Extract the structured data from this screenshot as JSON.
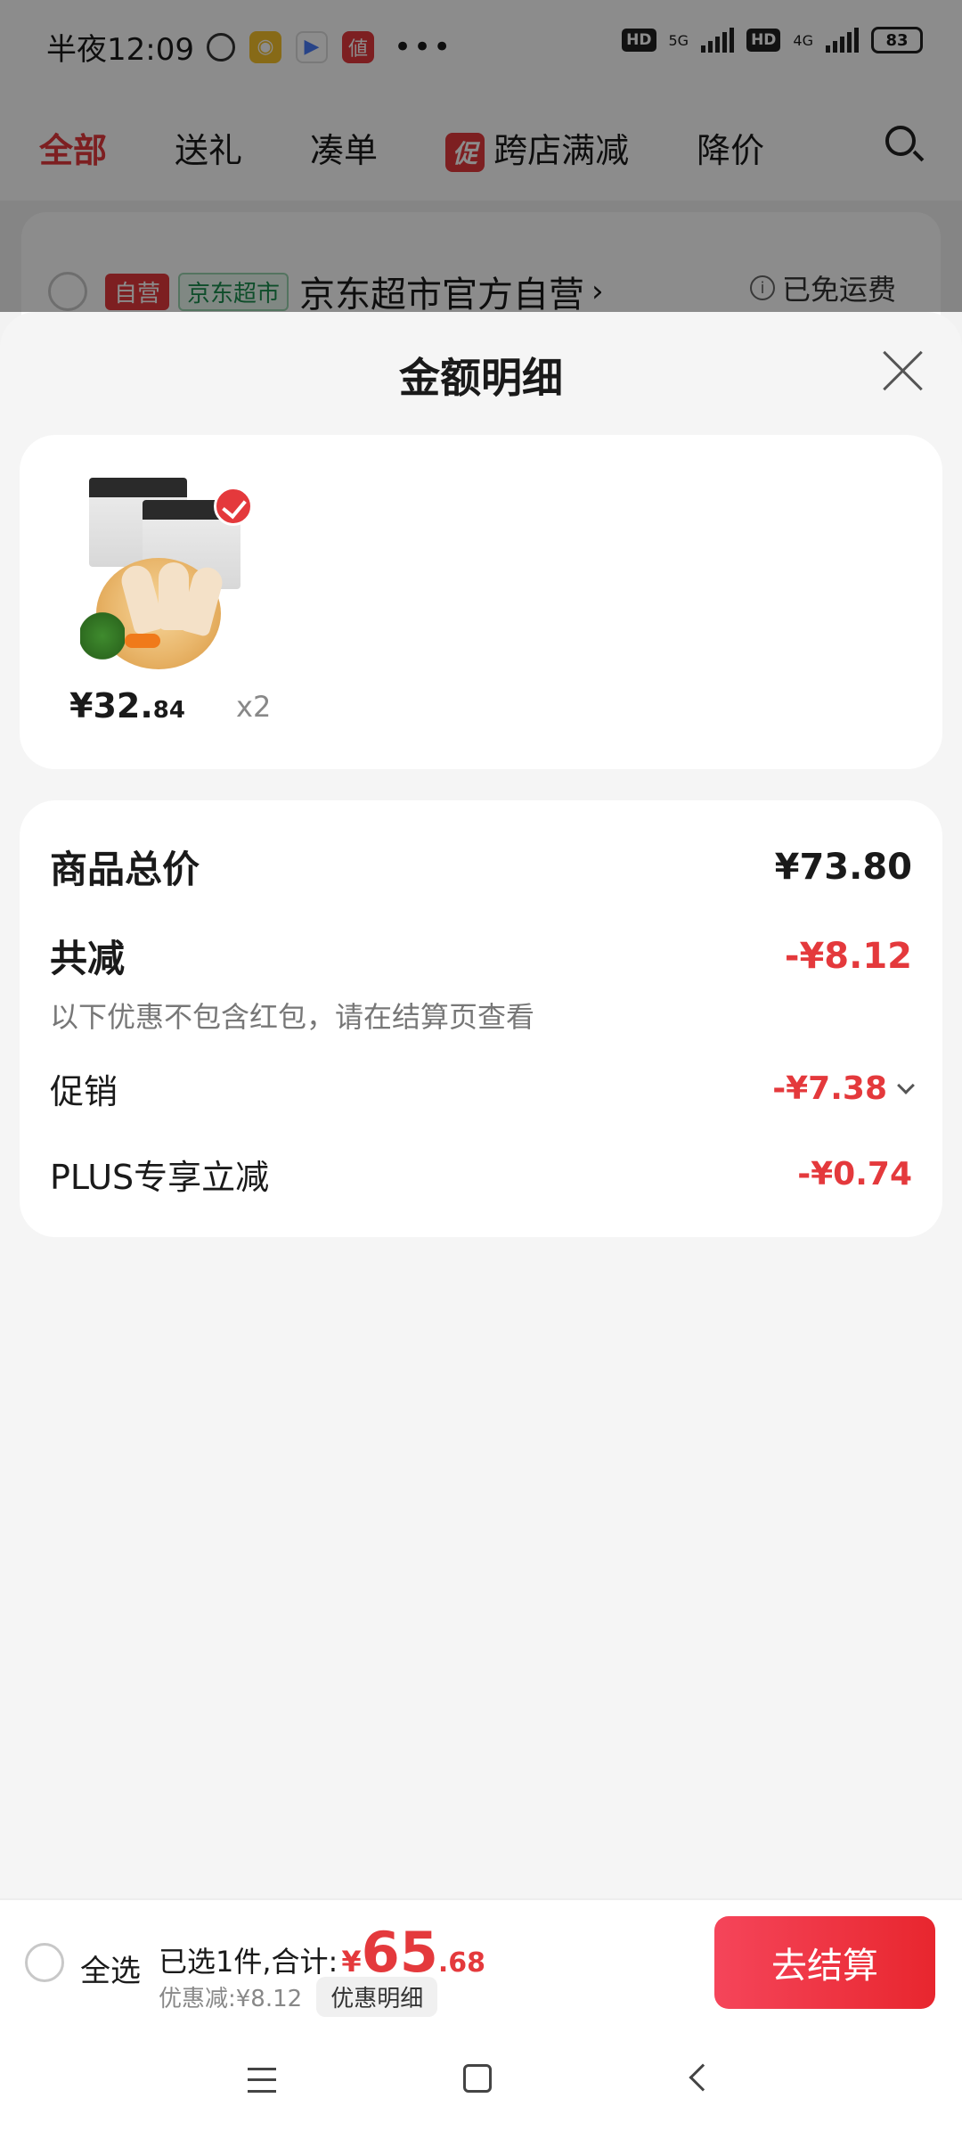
{
  "status_bar": {
    "time": "半夜12:09",
    "dots": "•••",
    "hd1": "HD",
    "net1": "5G",
    "hd2": "HD",
    "net2": "4G",
    "battery": "83"
  },
  "tabs": [
    {
      "label": "全部",
      "active": true
    },
    {
      "label": "送礼"
    },
    {
      "label": "凑单"
    },
    {
      "label": "跨店满减",
      "badge": "促"
    },
    {
      "label": "降价"
    }
  ],
  "store": {
    "tag_self": "自营",
    "tag_market": "京东超市",
    "name": "京东超市官方自营",
    "chevron": "›",
    "shipping": "已免运费",
    "info_glyph": "i"
  },
  "sheet": {
    "title": "金额明细"
  },
  "product": {
    "price_main": "¥32.",
    "price_cents": "84",
    "quantity": "x2"
  },
  "details": {
    "total_label": "商品总价",
    "total_value": "¥73.80",
    "reduce_label": "共减",
    "reduce_value": "-¥8.12",
    "note": "以下优惠不包含红包，请在结算页查看",
    "promo_label": "促销",
    "promo_value": "-¥7.38",
    "plus_label": "PLUS专享立减",
    "plus_value": "-¥0.74"
  },
  "checkout": {
    "select_all": "全选",
    "summary_prefix": "已选1件,合计:",
    "currency": "¥",
    "amount_int": "65",
    "amount_dec": ".68",
    "discount_text": "优惠减:¥8.12",
    "detail_button": "优惠明细",
    "pay_button": "去结算"
  },
  "colors": {
    "accent": "#e4393c",
    "overlay": "rgba(0,0,0,0.45)"
  }
}
